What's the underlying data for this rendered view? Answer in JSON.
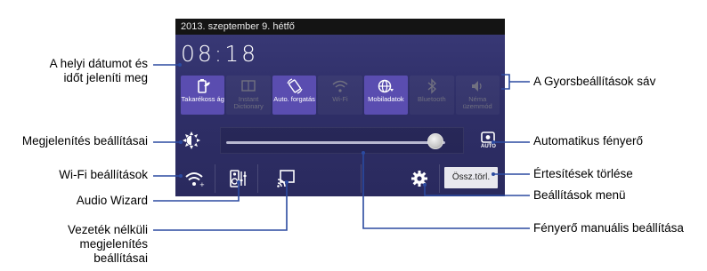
{
  "status": {
    "date": "2013. szeptember 9. hétfő",
    "time": "08:18"
  },
  "quick_settings": [
    {
      "label": "Takarékoss ág",
      "state": "on",
      "icon": "power-saver-icon"
    },
    {
      "label": "Instant Dictionary",
      "state": "off",
      "icon": "dictionary-icon"
    },
    {
      "label": "Auto. forgatás",
      "state": "on",
      "icon": "auto-rotate-icon"
    },
    {
      "label": "Wi-Fi",
      "state": "off",
      "icon": "wifi-icon"
    },
    {
      "label": "Mobiladatok",
      "state": "on",
      "icon": "mobile-data-icon"
    },
    {
      "label": "Bluetooth",
      "state": "off",
      "icon": "bluetooth-icon"
    },
    {
      "label": "Néma üzemmód",
      "state": "off",
      "icon": "silent-mode-icon"
    }
  ],
  "brightness": {
    "level": 0.92,
    "auto_label": "AUTO"
  },
  "bottom_bar": {
    "clear_label": "Össz.törl."
  },
  "callouts": {
    "datetime": [
      "A helyi dátumot és",
      "időt jeleníti meg"
    ],
    "display_settings": "Megjelenítés beállításai",
    "wifi_settings": "Wi-Fi beállítások",
    "audio_wizard": "Audio Wizard",
    "wireless_display": [
      "Vezeték nélküli",
      "megjelenítés",
      "beállításai"
    ],
    "quick_settings_bar": "A Gyorsbeállítások sáv",
    "auto_brightness": "Automatikus fényerő",
    "clear_notifications": "Értesítések törlése",
    "settings_menu": "Beállítások menü",
    "manual_brightness": "Fényerő manuális beállítása"
  },
  "colors": {
    "panel": "#2f2f68",
    "tile_on": "#5a4db0",
    "line": "#2b4aa0"
  }
}
